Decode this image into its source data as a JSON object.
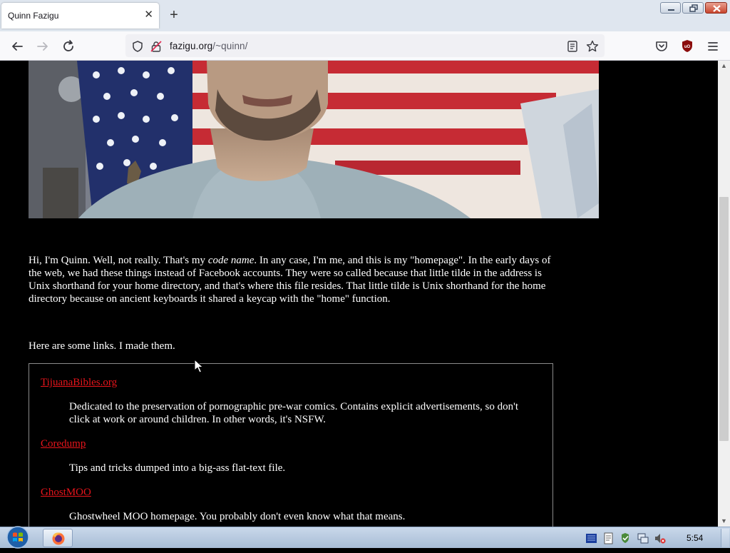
{
  "browser": {
    "tab_title": "Quinn Fazigu",
    "tab_close": "✕",
    "new_tab": "+",
    "url_host": "fazigu.org",
    "url_path": "/~quinn/"
  },
  "page": {
    "intro_1": "Hi, I'm Quinn. Well, not really. That's my ",
    "intro_em": "code name",
    "intro_2": ". In any case, I'm me, and this is my \"homepage\". In the early days of the web, we had these things instead of Facebook accounts. They were so called because that little tilde in the address is Unix shorthand for your home directory, and that's where this file resides. That little tilde is Unix shorthand for the home directory because on ancient keyboards it shared a keycap with the \"home\" function.",
    "links_heading": "Here are some links. I made them.",
    "links": [
      {
        "title": "TijuanaBibles.org",
        "description": "Dedicated to the preservation of pornographic pre-war comics. Contains explicit advertisements, so don't click at work or around children. In other words, it's NSFW."
      },
      {
        "title": "Coredump",
        "description": "Tips and tricks dumped into a big-ass flat-text file."
      },
      {
        "title": "GhostMOO",
        "description": "Ghostwheel MOO homepage. You probably don't even know what that means."
      }
    ]
  },
  "taskbar": {
    "clock": "5:54"
  },
  "colors": {
    "page_background": "#000000",
    "page_text": "#ffffff",
    "link": "#e8141b"
  },
  "icons": [
    "back-icon",
    "forward-icon",
    "reload-icon",
    "shield-icon",
    "insecure-lock-icon",
    "reader-view-icon",
    "bookmark-star-icon",
    "pocket-icon",
    "ublock-icon",
    "menu-icon",
    "windows-start-icon",
    "firefox-icon",
    "keyboard-icon",
    "notepad-icon",
    "security-icon",
    "network-icon",
    "volume-muted-icon"
  ]
}
